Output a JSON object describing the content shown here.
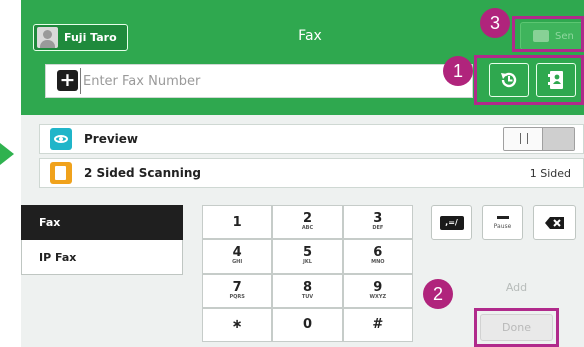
{
  "header": {
    "user_name": "Fuji Taro",
    "title": "Fax",
    "send_label": "Sen"
  },
  "fax_number": {
    "placeholder": "Enter Fax Number",
    "value": ""
  },
  "rows": {
    "preview": {
      "label": "Preview"
    },
    "two_sided": {
      "label": "2 Sided Scanning",
      "value": "1 Sided"
    }
  },
  "tabs": [
    {
      "label": "Fax",
      "selected": true
    },
    {
      "label": "IP Fax",
      "selected": false
    }
  ],
  "keypad": [
    {
      "digit": "1",
      "letters": ""
    },
    {
      "digit": "2",
      "letters": "ABC"
    },
    {
      "digit": "3",
      "letters": "DEF"
    },
    {
      "digit": "4",
      "letters": "GHI"
    },
    {
      "digit": "5",
      "letters": "JKL"
    },
    {
      "digit": "6",
      "letters": "MNO"
    },
    {
      "digit": "7",
      "letters": "PQRS"
    },
    {
      "digit": "8",
      "letters": "TUV"
    },
    {
      "digit": "9",
      "letters": "WXYZ"
    },
    {
      "digit": "∗",
      "letters": ""
    },
    {
      "digit": "0",
      "letters": ""
    },
    {
      "digit": "#",
      "letters": ""
    }
  ],
  "side_keys": {
    "dtmf_label": ",=/",
    "pause_label": "Pause"
  },
  "actions": {
    "add_label": "Add",
    "done_label": "Done"
  },
  "callouts": [
    "1",
    "2",
    "3"
  ],
  "colors": {
    "header_green": "#2fa84f",
    "callout_magenta": "#b0247c",
    "arrow_green": "#2fb24f"
  },
  "icons": {
    "history": "history-icon",
    "address_book": "address-book-icon",
    "backspace": "backspace-icon"
  }
}
